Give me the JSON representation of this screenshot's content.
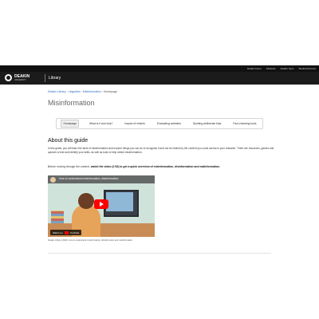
{
  "top_links": [
    "Deakin home",
    "Students",
    "Deakin Sync",
    "StudentConnect"
  ],
  "header": {
    "logo_main": "DEAKIN",
    "logo_sub": "UNIVERSITY",
    "section": "Library"
  },
  "breadcrumb": [
    "Deakin Library",
    "Libguides",
    "Misinformation",
    "Homepage"
  ],
  "page_title": "Misinformation",
  "tabs": [
    {
      "label": "Homepage",
      "active": true
    },
    {
      "label": "What is it and why?",
      "active": false
    },
    {
      "label": "Impact of misinfo",
      "active": false
    },
    {
      "label": "Evaluating websites",
      "active": false
    },
    {
      "label": "Spotting deliberate bias",
      "active": false
    },
    {
      "label": "Fact-checking tools",
      "active": false
    }
  ],
  "about": {
    "heading": "About this guide",
    "intro": "In this guide, you will learn the facts of misinformation and explore things you can do to recognise it and not be misled by the content you come across in your research. There are resources, games and quizzes to test and identify your skills, as well as tools to help detect misinformation.",
    "before_prefix": "Before moving through the content, ",
    "before_bold": "watch the video (2:52) to get a quick overview of misinformation, disinformation and malinformation."
  },
  "video": {
    "title": "How to understand misinformation, disinformation",
    "watch_on": "Watch on",
    "youtube": "YouTube"
  },
  "caption": "Deakin Library (2020). How to understand misinformation, disinformation and malinformation."
}
